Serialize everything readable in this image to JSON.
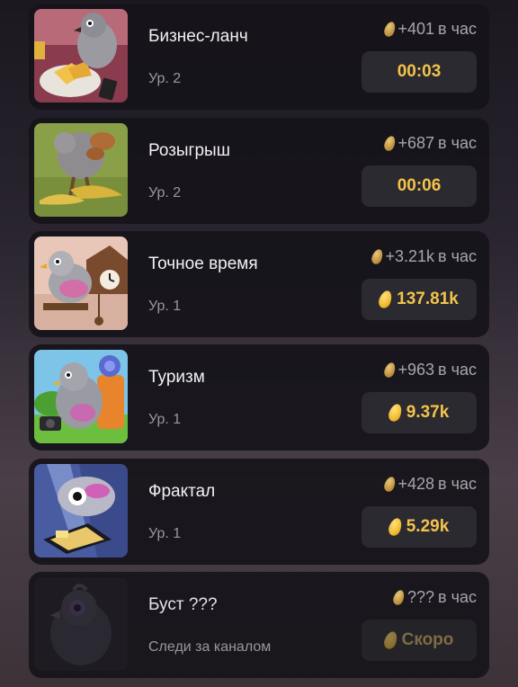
{
  "income_suffix": "в час",
  "cards": [
    {
      "title": "Бизнес-ланч",
      "level": "Ур. 2",
      "income": "+401",
      "button": "00:03",
      "button_type": "timer",
      "image": "pigeon-business-lunch"
    },
    {
      "title": "Розыгрыш",
      "level": "Ур. 2",
      "income": "+687",
      "button": "00:06",
      "button_type": "timer",
      "image": "pigeon-prank"
    },
    {
      "title": "Точное время",
      "level": "Ур. 1",
      "income": "+3.21k",
      "button": "137.81k",
      "button_type": "price",
      "image": "pigeon-cuckoo-clock"
    },
    {
      "title": "Туризм",
      "level": "Ур. 1",
      "income": "+963",
      "button": "9.37k",
      "button_type": "price",
      "image": "pigeon-tourist"
    },
    {
      "title": "Фрактал",
      "level": "Ур. 1",
      "income": "+428",
      "button": "5.29k",
      "button_type": "price",
      "image": "pigeon-fractal"
    },
    {
      "title": "Буст ???",
      "level": "Следи за каналом",
      "income": "???",
      "button": "Скоро",
      "button_type": "locked",
      "image": "pigeon-locked"
    }
  ],
  "colors": {
    "accent": "#f3c34a",
    "card_bg": "#16141a",
    "button_bg": "#2b2a30"
  }
}
